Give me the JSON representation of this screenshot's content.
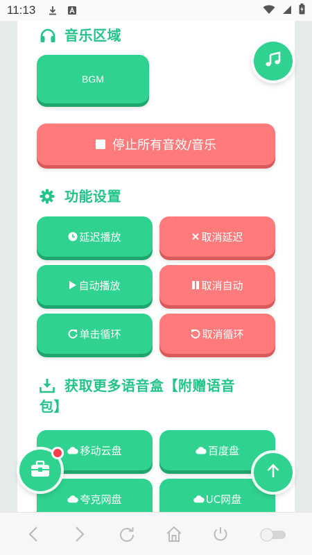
{
  "status": {
    "time": "11:13"
  },
  "music": {
    "title": "音乐区域",
    "bgm_label": "BGM",
    "stop_label": "停止所有音效/音乐"
  },
  "function": {
    "title": "功能设置",
    "buttons": [
      {
        "label": "延迟播放",
        "icon": "clock-icon"
      },
      {
        "label": "取消延迟",
        "icon": "x-icon"
      },
      {
        "label": "自动播放",
        "icon": "play-icon"
      },
      {
        "label": "取消自动",
        "icon": "pause-icon"
      },
      {
        "label": "单击循环",
        "icon": "redo-icon"
      },
      {
        "label": "取消循环",
        "icon": "undo-icon"
      }
    ]
  },
  "download": {
    "title_line1": "获取更多语音盒【附赠语音",
    "title_line2": "包】",
    "buttons": [
      {
        "label": "移动云盘",
        "icon": "cloud-icon"
      },
      {
        "label": "百度盘",
        "icon": "cloud-icon"
      },
      {
        "label": "夸克网盘",
        "icon": "cloud-icon"
      },
      {
        "label": "UC网盘",
        "icon": "cloud-icon"
      }
    ]
  },
  "colors": {
    "accent": "#2fd38f",
    "danger": "#ff7b7b",
    "title": "#24c489"
  }
}
